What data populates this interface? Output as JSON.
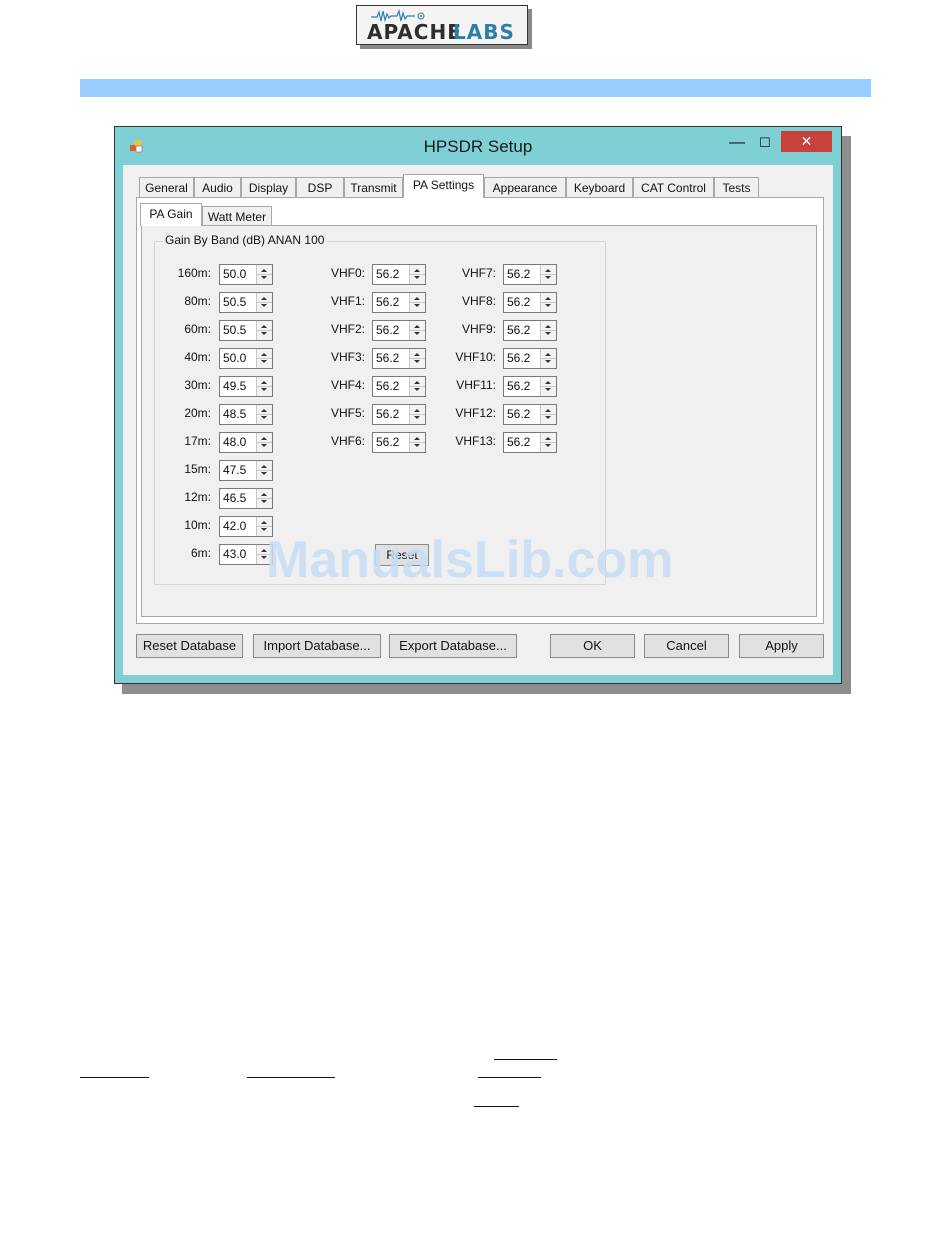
{
  "logo": {
    "part1": "APACHE",
    "part2": "LABS"
  },
  "window": {
    "title": "HPSDR Setup",
    "minimize": "—",
    "maximize": "☐",
    "close": "✕"
  },
  "tabs": [
    {
      "label": "General"
    },
    {
      "label": "Audio"
    },
    {
      "label": "Display"
    },
    {
      "label": "DSP"
    },
    {
      "label": "Transmit"
    },
    {
      "label": "PA Settings"
    },
    {
      "label": "Appearance"
    },
    {
      "label": "Keyboard"
    },
    {
      "label": "CAT Control"
    },
    {
      "label": "Tests"
    }
  ],
  "active_tab": "PA Settings",
  "subtabs": [
    {
      "label": "PA Gain"
    },
    {
      "label": "Watt Meter"
    }
  ],
  "groupbox_title": "Gain By Band (dB) ANAN 100",
  "hf_bands": [
    {
      "label": "160m:",
      "value": "50.0"
    },
    {
      "label": "80m:",
      "value": "50.5"
    },
    {
      "label": "60m:",
      "value": "50.5"
    },
    {
      "label": "40m:",
      "value": "50.0"
    },
    {
      "label": "30m:",
      "value": "49.5"
    },
    {
      "label": "20m:",
      "value": "48.5"
    },
    {
      "label": "17m:",
      "value": "48.0"
    },
    {
      "label": "15m:",
      "value": "47.5"
    },
    {
      "label": "12m:",
      "value": "46.5"
    },
    {
      "label": "10m:",
      "value": "42.0"
    },
    {
      "label": "6m:",
      "value": "43.0"
    }
  ],
  "vhf_col1": [
    {
      "label": "VHF0:",
      "value": "56.2"
    },
    {
      "label": "VHF1:",
      "value": "56.2"
    },
    {
      "label": "VHF2:",
      "value": "56.2"
    },
    {
      "label": "VHF3:",
      "value": "56.2"
    },
    {
      "label": "VHF4:",
      "value": "56.2"
    },
    {
      "label": "VHF5:",
      "value": "56.2"
    },
    {
      "label": "VHF6:",
      "value": "56.2"
    }
  ],
  "vhf_col2": [
    {
      "label": "VHF7:",
      "value": "56.2"
    },
    {
      "label": "VHF8:",
      "value": "56.2"
    },
    {
      "label": "VHF9:",
      "value": "56.2"
    },
    {
      "label": "VHF10:",
      "value": "56.2"
    },
    {
      "label": "VHF11:",
      "value": "56.2"
    },
    {
      "label": "VHF12:",
      "value": "56.2"
    },
    {
      "label": "VHF13:",
      "value": "56.2"
    }
  ],
  "reset_label": "Reset",
  "bottom_buttons": {
    "reset_db": "Reset Database",
    "import_db": "Import Database...",
    "export_db": "Export Database...",
    "ok": "OK",
    "cancel": "Cancel",
    "apply": "Apply"
  },
  "watermark": "ManualsLib.com",
  "colors": {
    "header_bar": "#99ccff",
    "window_frame": "#7fd0d4",
    "close_button": "#c7413d"
  }
}
